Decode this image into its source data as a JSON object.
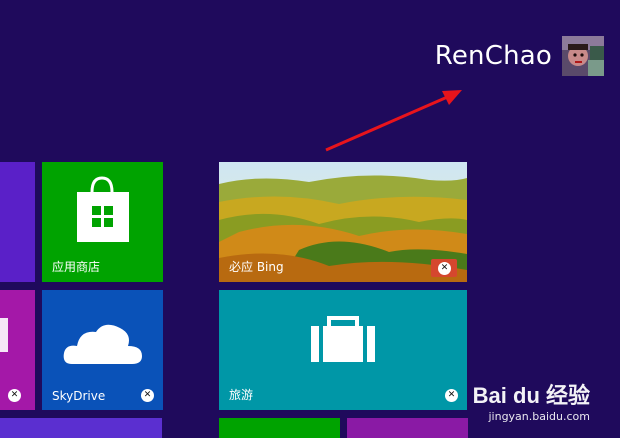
{
  "user": {
    "name": "RenChao"
  },
  "tiles": {
    "store": {
      "label": "应用商店"
    },
    "skydrive": {
      "label": "SkyDrive",
      "close": "✕"
    },
    "bing": {
      "label": "必应 Bing",
      "close": "✕"
    },
    "travel": {
      "label": "旅游",
      "close": "✕"
    },
    "left_magenta": {
      "close": "✕"
    }
  },
  "watermark": {
    "logo": "Bai du 经验",
    "url": "jingyan.baidu.com"
  },
  "colors": {
    "background": "#1f0a5c",
    "store": "#00a300",
    "skydrive": "#0a52b8",
    "travel": "#0097a7",
    "arrow": "#e8141c"
  },
  "icons": {
    "store": "shopping-bag-windows-icon",
    "skydrive": "cloud-icon",
    "travel": "suitcase-icon"
  }
}
